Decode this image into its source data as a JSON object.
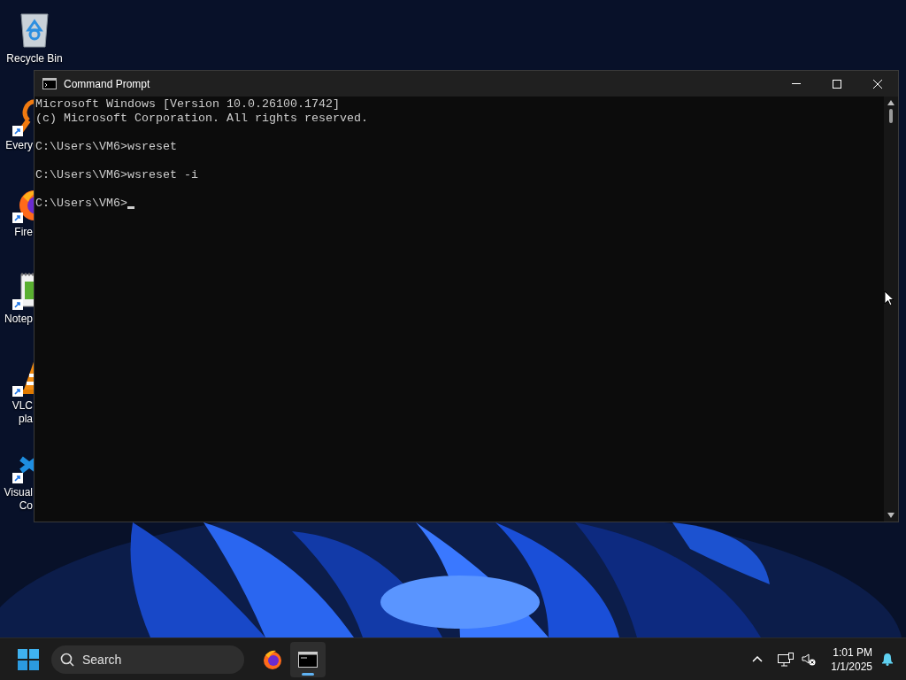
{
  "desktop_icons": [
    {
      "kind": "recycle-bin",
      "label_lines": [
        "Recycle Bin"
      ]
    },
    {
      "kind": "magnifier",
      "label_lines": [
        "Every"
      ]
    },
    {
      "kind": "firefox",
      "label_lines": [
        "Fire"
      ]
    },
    {
      "kind": "notepad",
      "label_lines": [
        "Notep"
      ]
    },
    {
      "kind": "cone",
      "label_lines": [
        "VLC",
        "pla"
      ]
    },
    {
      "kind": "code",
      "label_lines": [
        "Visual",
        "Co"
      ]
    }
  ],
  "window": {
    "title": "Command Prompt",
    "blocks": [
      [
        "Microsoft Windows [Version 10.0.26100.1742]",
        "(c) Microsoft Corporation. All rights reserved."
      ],
      [
        "C:\\Users\\VM6>wsreset"
      ],
      [
        "C:\\Users\\VM6>wsreset -i"
      ],
      [
        "C:\\Users\\VM6>"
      ]
    ]
  },
  "taskbar": {
    "search": {
      "placeholder": "Search"
    },
    "apps": [
      {
        "kind": "firefox",
        "active": false
      },
      {
        "kind": "console",
        "active": true
      }
    ],
    "clock": {
      "time": "1:01 PM",
      "date": "1/1/2025"
    }
  }
}
